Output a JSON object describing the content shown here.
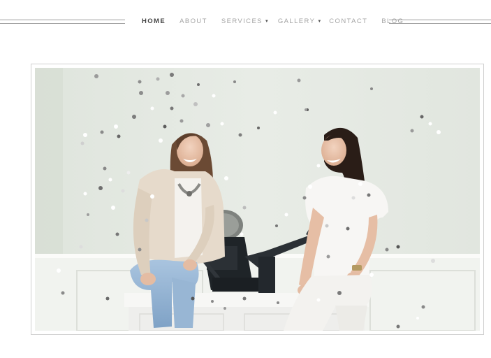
{
  "nav": {
    "items": [
      {
        "label": "HOME",
        "active": true,
        "has_dropdown": false
      },
      {
        "label": "ABOUT",
        "active": false,
        "has_dropdown": false
      },
      {
        "label": "SERVICES",
        "active": false,
        "has_dropdown": true
      },
      {
        "label": "GALLERY",
        "active": false,
        "has_dropdown": true
      },
      {
        "label": "CONTACT",
        "active": false,
        "has_dropdown": false
      },
      {
        "label": "BLOG",
        "active": false,
        "has_dropdown": false
      }
    ],
    "dropdown_icon": "caret-down-icon"
  },
  "hero": {
    "subject": "two smiling women seated on a white bench beside a black letterpress while silver and white confetti falls"
  },
  "colors": {
    "nav_active": "#444444",
    "nav_inactive": "#a4a4a4",
    "rule": "#9a9a9a",
    "frame_border": "#cfcfcf",
    "wall": "#e4e9e2"
  }
}
